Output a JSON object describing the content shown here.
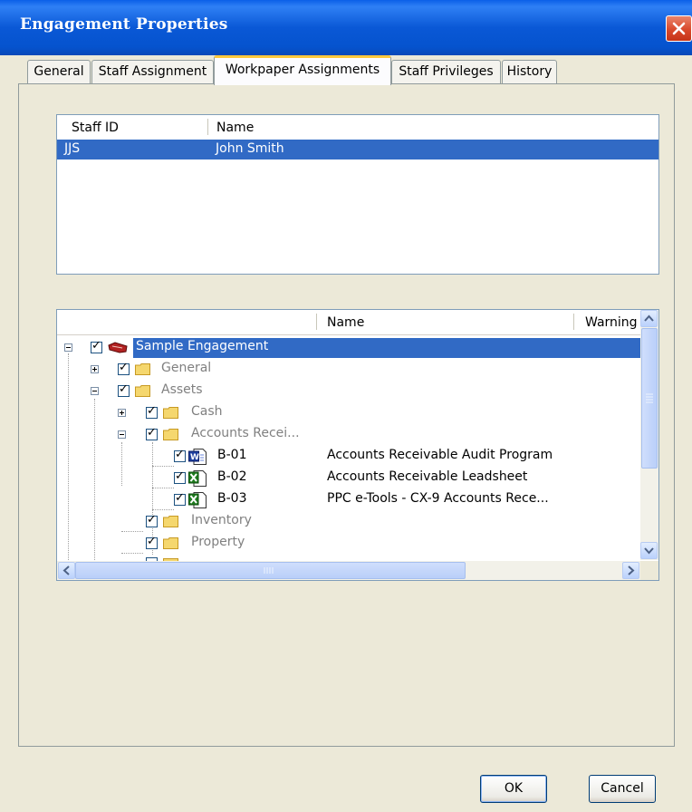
{
  "window": {
    "title": "Engagement Properties"
  },
  "tabs": [
    {
      "label": "General"
    },
    {
      "label": "Staff Assignment"
    },
    {
      "label": "Workpaper Assignments",
      "active": true
    },
    {
      "label": "Staff Privileges"
    },
    {
      "label": "History"
    }
  ],
  "staff_list": {
    "columns": [
      "Staff ID",
      "Name"
    ],
    "rows": [
      {
        "id": "JJS",
        "name": "John Smith",
        "selected": true
      }
    ]
  },
  "tree": {
    "columns": [
      "Name",
      "Warning"
    ],
    "nodes": [
      {
        "label": "Sample Engagement",
        "selected": true
      },
      {
        "label": "General"
      },
      {
        "label": "Assets"
      },
      {
        "label": "Cash"
      },
      {
        "label": "Accounts Recei..."
      },
      {
        "label": "B-01",
        "name": "Accounts Receivable Audit Program",
        "icon": "word-doc-icon"
      },
      {
        "label": "B-02",
        "name": "Accounts Receivable Leadsheet",
        "icon": "excel-doc-icon"
      },
      {
        "label": "B-03",
        "name": "PPC e-Tools - CX-9 Accounts Rece...",
        "icon": "excel-doc-icon"
      },
      {
        "label": "Inventory"
      },
      {
        "label": "Property"
      }
    ]
  },
  "buttons": {
    "ok": "OK",
    "cancel": "Cancel"
  },
  "colors": {
    "selection": "#316AC5",
    "titlebar": "#0A58D6",
    "tab_highlight": "#FFC83C"
  }
}
